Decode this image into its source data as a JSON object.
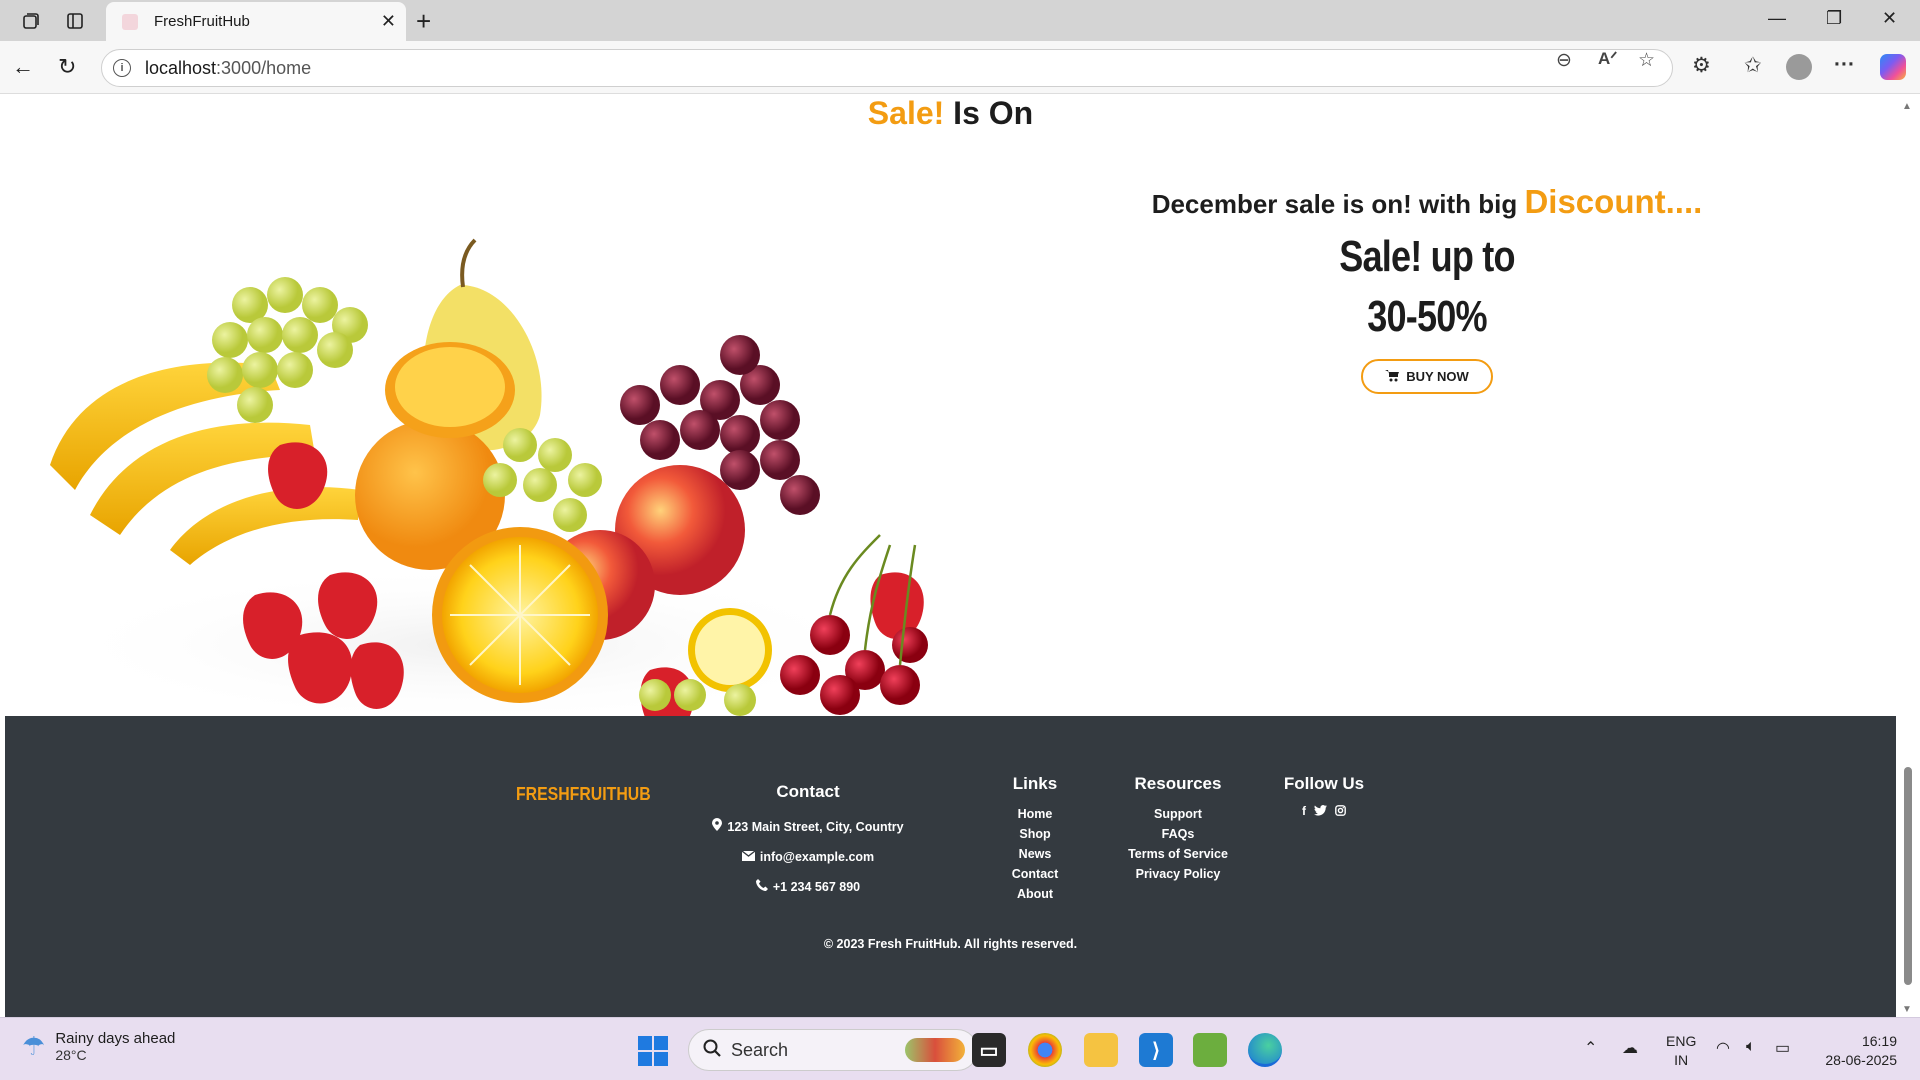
{
  "browser": {
    "tab_title": "FreshFruitHub",
    "url_host": "localhost",
    "url_path": ":3000/home"
  },
  "page": {
    "sale_heading_accent": "Sale!",
    "sale_heading_rest": " Is On",
    "promo_line_text": "December sale is on! with big ",
    "promo_line_accent": "Discount....",
    "promo_big_1": "Sale! up to",
    "promo_big_2": "30-50%",
    "buy_button": "BUY NOW"
  },
  "footer": {
    "brand": "FRESHFRUITHUB",
    "contact": {
      "heading": "Contact",
      "address": "123 Main Street, City, Country",
      "email": "info@example.com",
      "phone": "+1 234 567 890"
    },
    "links": {
      "heading": "Links",
      "items": [
        "Home",
        "Shop",
        "News",
        "Contact",
        "About"
      ]
    },
    "resources": {
      "heading": "Resources",
      "items": [
        "Support",
        "FAQs",
        "Terms of Service",
        "Privacy Policy"
      ]
    },
    "follow": {
      "heading": "Follow Us",
      "icons": [
        "facebook-icon",
        "twitter-icon",
        "instagram-icon"
      ]
    },
    "copyright": "© 2023 Fresh FruitHub. All rights reserved."
  },
  "taskbar": {
    "weather_title": "Rainy days ahead",
    "weather_temp": "28°C",
    "search_placeholder": "Search",
    "lang_1": "ENG",
    "lang_2": "IN",
    "time": "16:19",
    "date": "28-06-2025"
  },
  "colors": {
    "accent": "#f39c12",
    "footer_bg": "#343a40"
  }
}
